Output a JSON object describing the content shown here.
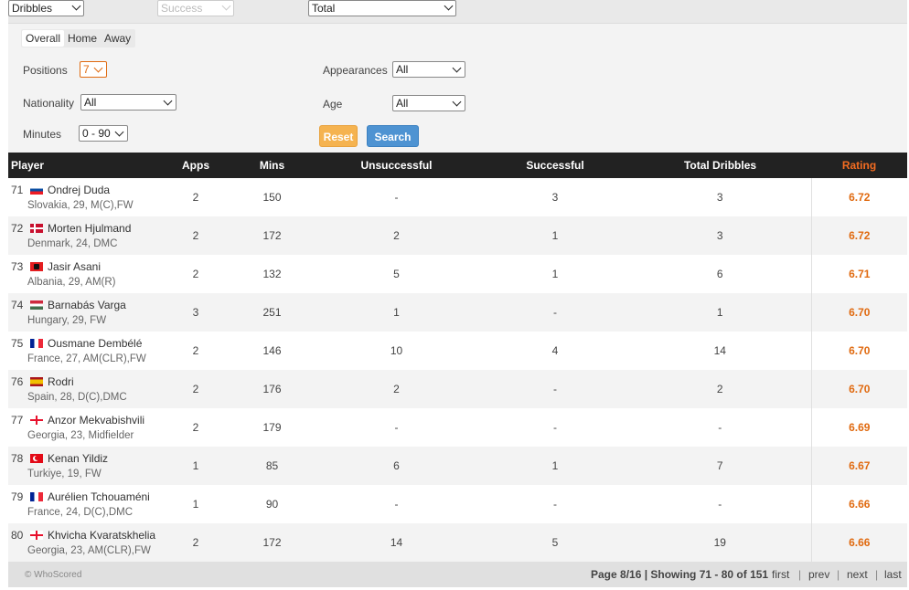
{
  "top_controls": {
    "category": "Dribbles",
    "subcategory": "Success",
    "type": "Total"
  },
  "tabs": [
    "Overall",
    "Home",
    "Away"
  ],
  "filters": {
    "positions_label": "Positions",
    "positions_value": "7",
    "appearances_label": "Appearances",
    "appearances_value": "All",
    "nationality_label": "Nationality",
    "nationality_value": "All",
    "age_label": "Age",
    "age_value": "All",
    "minutes_label": "Minutes",
    "minutes_value": "0 - 90",
    "reset_label": "Reset",
    "search_label": "Search"
  },
  "table": {
    "columns": [
      "Player",
      "Apps",
      "Mins",
      "Unsuccessful",
      "Successful",
      "Total Dribbles",
      "Rating"
    ],
    "rows": [
      {
        "rank": "71",
        "flag": "slovakia-flag",
        "name": "Ondrej Duda",
        "meta": "Slovakia,  29, M(C),FW",
        "apps": "2",
        "mins": "150",
        "unsuccessful": "-",
        "successful": "3",
        "total": "3",
        "rating": "6.72"
      },
      {
        "rank": "72",
        "flag": "denmark-flag",
        "name": "Morten Hjulmand",
        "meta": "Denmark,  24, DMC",
        "apps": "2",
        "mins": "172",
        "unsuccessful": "2",
        "successful": "1",
        "total": "3",
        "rating": "6.72"
      },
      {
        "rank": "73",
        "flag": "albania-flag",
        "name": "Jasir Asani",
        "meta": "Albania,  29, AM(R)",
        "apps": "2",
        "mins": "132",
        "unsuccessful": "5",
        "successful": "1",
        "total": "6",
        "rating": "6.71"
      },
      {
        "rank": "74",
        "flag": "hungary-flag",
        "name": "Barnabás Varga",
        "meta": "Hungary,  29, FW",
        "apps": "3",
        "mins": "251",
        "unsuccessful": "1",
        "successful": "-",
        "total": "1",
        "rating": "6.70"
      },
      {
        "rank": "75",
        "flag": "france-flag",
        "name": "Ousmane Dembélé",
        "meta": "France,  27, AM(CLR),FW",
        "apps": "2",
        "mins": "146",
        "unsuccessful": "10",
        "successful": "4",
        "total": "14",
        "rating": "6.70"
      },
      {
        "rank": "76",
        "flag": "spain-flag",
        "name": "Rodri",
        "meta": "Spain,  28, D(C),DMC",
        "apps": "2",
        "mins": "176",
        "unsuccessful": "2",
        "successful": "-",
        "total": "2",
        "rating": "6.70"
      },
      {
        "rank": "77",
        "flag": "georgia-flag",
        "name": "Anzor Mekvabishvili",
        "meta": "Georgia,  23, Midfielder",
        "apps": "2",
        "mins": "179",
        "unsuccessful": "-",
        "successful": "-",
        "total": "-",
        "rating": "6.69"
      },
      {
        "rank": "78",
        "flag": "turkey-flag",
        "name": "Kenan Yildiz",
        "meta": "Turkiye,  19, FW",
        "apps": "1",
        "mins": "85",
        "unsuccessful": "6",
        "successful": "1",
        "total": "7",
        "rating": "6.67"
      },
      {
        "rank": "79",
        "flag": "france-flag",
        "name": "Aurélien Tchouaméni",
        "meta": "France,  24, D(C),DMC",
        "apps": "1",
        "mins": "90",
        "unsuccessful": "-",
        "successful": "-",
        "total": "-",
        "rating": "6.66"
      },
      {
        "rank": "80",
        "flag": "georgia-flag",
        "name": "Khvicha Kvaratskhelia",
        "meta": "Georgia,  23, AM(CLR),FW",
        "apps": "2",
        "mins": "172",
        "unsuccessful": "14",
        "successful": "5",
        "total": "19",
        "rating": "6.66"
      }
    ]
  },
  "footer": {
    "copyright": "© WhoScored",
    "page_info": "Page 8/16 | Showing 71 - 80 of 151",
    "first": "first",
    "prev": "prev",
    "next": "next",
    "last": "last",
    "separator": "|"
  },
  "colors": {
    "accent": "#e06a10",
    "header_bg": "#222222",
    "reset_button": "#f5b350",
    "search_button": "#4e93d2"
  }
}
